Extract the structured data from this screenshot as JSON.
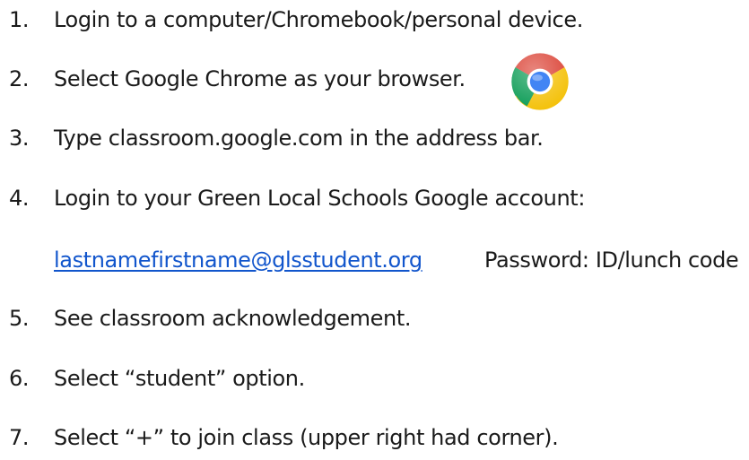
{
  "steps": [
    {
      "number": "1.",
      "text": "Login to a computer/Chromebook/personal device."
    },
    {
      "number": "2.",
      "text": "Select Google Chrome as your browser."
    },
    {
      "number": "3.",
      "text": "Type classroom.google.com in the address bar."
    },
    {
      "number": "4.",
      "text": "Login to your Green Local Schools Google account:"
    },
    {
      "number": "5.",
      "text": "See classroom acknowledgement."
    },
    {
      "number": "6.",
      "text": "Select “student” option."
    },
    {
      "number": "7.",
      "text": "Select “+” to join class (upper right had corner)."
    }
  ],
  "login": {
    "email": "lastnamefirstname@glsstudent.org",
    "password_text": "Password: ID/lunch code"
  },
  "icons": {
    "browser_logo": "chrome-logo-icon"
  },
  "colors": {
    "link": "#1155cc",
    "text": "#1a1a1a",
    "chrome_red": "#db4437",
    "chrome_yellow": "#f4c20d",
    "chrome_green": "#0f9d58",
    "chrome_blue": "#4285f4"
  }
}
